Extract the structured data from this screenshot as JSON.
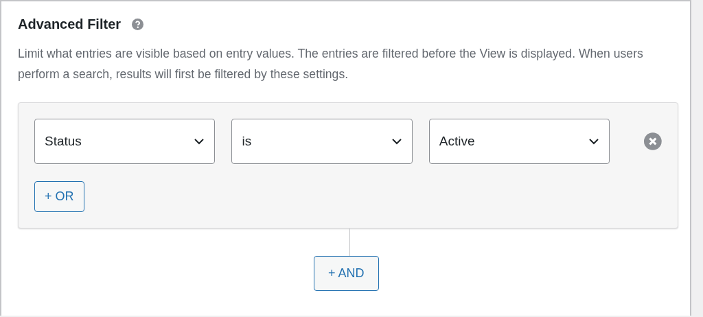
{
  "section": {
    "title": "Advanced Filter",
    "description": "Limit what entries are visible based on entry values. The entries are filtered before the View is displayed. When users perform a search, results will first be filtered by these settings."
  },
  "filter_group": {
    "conditions": [
      {
        "field": "Status",
        "operator": "is",
        "value": "Active"
      }
    ],
    "or_button": "+ OR"
  },
  "and_button": "+ AND"
}
